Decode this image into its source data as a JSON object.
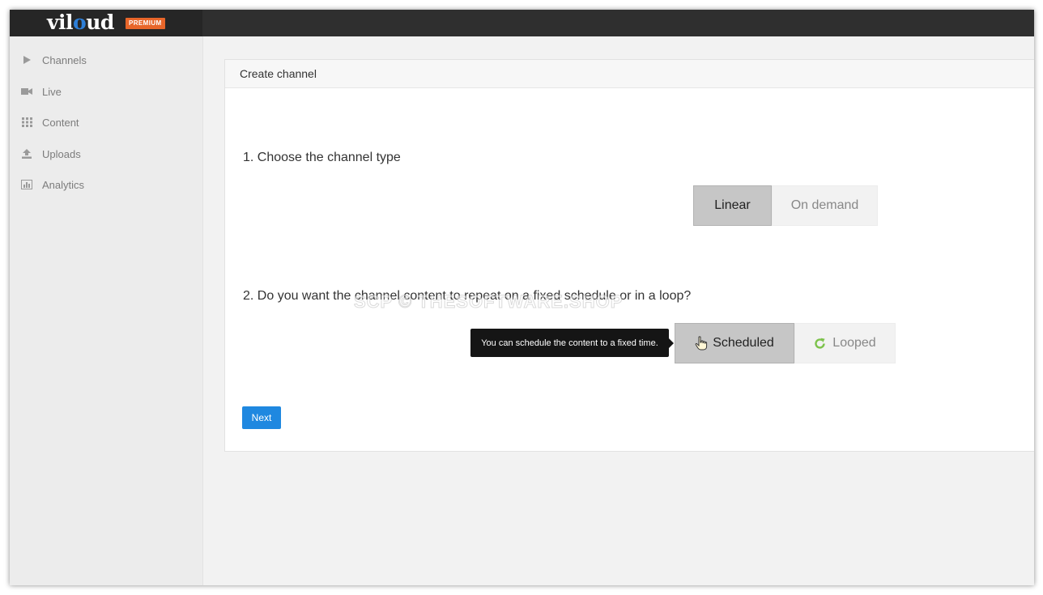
{
  "brand": {
    "name_prefix": "vil",
    "name_o": "o",
    "name_suffix": "ud",
    "badge": "PREMIUM",
    "accent_color": "#e8662a"
  },
  "sidebar": {
    "items": [
      {
        "label": "Channels",
        "icon": "play-icon"
      },
      {
        "label": "Live",
        "icon": "video-camera-icon"
      },
      {
        "label": "Content",
        "icon": "grid-icon"
      },
      {
        "label": "Uploads",
        "icon": "upload-icon"
      },
      {
        "label": "Analytics",
        "icon": "bar-chart-icon"
      }
    ]
  },
  "panel": {
    "title": "Create channel",
    "q1": "1. Choose the channel type",
    "q1_options": [
      {
        "label": "Linear",
        "selected": true
      },
      {
        "label": "On demand",
        "selected": false
      }
    ],
    "q2": "2. Do you want the channel content to repeat on a fixed schedule or in a loop?",
    "q2_options": [
      {
        "label": "Scheduled",
        "selected": true,
        "icon": "hand-pointer-icon"
      },
      {
        "label": "Looped",
        "selected": false,
        "icon": "refresh-icon"
      }
    ],
    "tooltip": "You can schedule the content to a fixed time.",
    "next_label": "Next"
  },
  "watermark": "SCP © THESOFTWARE.SHOP",
  "colors": {
    "primary_button": "#1f88e0",
    "selected_segment": "#c6c6c6",
    "topbar": "#2f2f2f"
  }
}
